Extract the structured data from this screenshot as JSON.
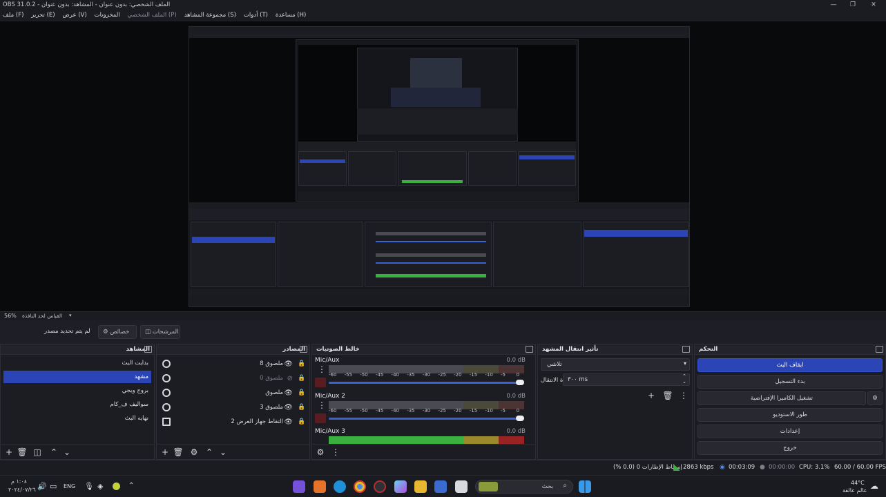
{
  "window": {
    "title": "OBS 31.0.2 - الملف الشخصي: بدون عنوان - المشاهد: بدون عنوان",
    "controls": [
      "—",
      "❐",
      "✕"
    ]
  },
  "menu": [
    "ملف (F)",
    "تحرير (E)",
    "عرض (V)",
    "المخزونات",
    "الملف الشخصي (P)",
    "مجموعة المشاهد (S)",
    "أدوات (T)",
    "مساعدة (H)"
  ],
  "zoom": {
    "value": "56%",
    "label": "القياس لحد النافذة"
  },
  "top_controls": {
    "transitions": "المرشحات",
    "properties": "خصائص",
    "no_source": "لم يتم تحديد مصدر"
  },
  "docks": {
    "scenes": {
      "title": "المشاهد",
      "items": [
        "بدايت البث",
        "مشهد",
        "بروج ويجي",
        "سواليف ف_كام",
        "نهايه البث"
      ],
      "selected": 1
    },
    "sources": {
      "title": "المصادر",
      "items": [
        {
          "name": "ملصوق 8",
          "dim": false
        },
        {
          "name": "ملصوق 0",
          "dim": true
        },
        {
          "name": "ملصوق",
          "dim": false
        },
        {
          "name": "ملصوق 3",
          "dim": false
        },
        {
          "name": "التقاط جهاز العرض 2",
          "dim": false
        }
      ]
    },
    "mixer": {
      "title": "خالط الصوتيات",
      "channels": [
        {
          "name": "Mic/Aux",
          "db": "0.0 dB",
          "active": false
        },
        {
          "name": "Mic/Aux 2",
          "db": "0.0 dB",
          "active": false
        },
        {
          "name": "Mic/Aux 3",
          "db": "0.0 dB",
          "active": true
        }
      ],
      "ticks": [
        "-60",
        "-55",
        "-50",
        "-45",
        "-40",
        "-35",
        "-30",
        "-25",
        "-20",
        "-15",
        "-10",
        "-5",
        "0"
      ]
    },
    "transitions": {
      "title": "تأثير انتقال المشهد",
      "type": "تلاشي",
      "duration_label": "مدة الانتقال",
      "duration_value": "٣٠٠ ms"
    },
    "controls": {
      "title": "التحكم",
      "buttons": [
        "ايقاف البث",
        "بدء التسجيل",
        "تشغيل الكاميرا الإفتراضية",
        "طور الاستوديو",
        "إعدادات",
        "خروج"
      ]
    }
  },
  "status": {
    "frames": "إسقاط الإطارات 0 (0.0 %)",
    "bitrate": "2863 kbps",
    "stream_time": "00:03:09",
    "rec_time": "00:00:00",
    "cpu": "CPU: 3.1%",
    "fps": "60.00 / 60.00 FPS"
  },
  "taskbar": {
    "time": "١:٠٤ م",
    "date": "٢٠٢٤/٠٧/٢٦",
    "lang": "ENG",
    "search": "بحث",
    "weather_temp": "44°C",
    "weather_desc": "عالم عالقة"
  },
  "colors": {
    "accent": "#2b44b6",
    "bg": "#1e1f26",
    "meter_green": "#3ab03e"
  }
}
